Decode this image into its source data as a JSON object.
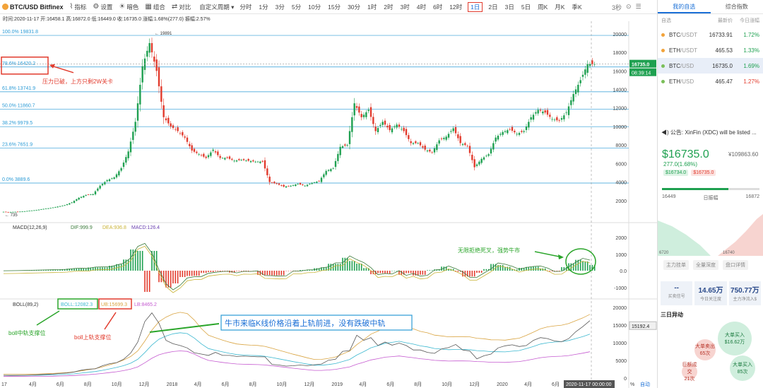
{
  "toolbar": {
    "pair": "BTC/USD Bitfinex",
    "tools": [
      {
        "icon": "indicator-icon",
        "glyph": "⌇",
        "label": "指标"
      },
      {
        "icon": "gear-icon",
        "glyph": "⚙",
        "label": "设置"
      },
      {
        "icon": "sun-icon",
        "glyph": "☀",
        "label": "暗色"
      },
      {
        "icon": "combo-icon",
        "glyph": "▦",
        "label": "组合"
      },
      {
        "icon": "compare-icon",
        "glyph": "⇄",
        "label": "对比"
      }
    ],
    "custom": "自定义周期 ▾",
    "periods": [
      "分时",
      "1分",
      "3分",
      "5分",
      "10分",
      "15分",
      "30分",
      "1时",
      "2时",
      "3时",
      "4时",
      "6时",
      "12时",
      "1日",
      "2日",
      "3日",
      "5日",
      "周K",
      "月K",
      "季K"
    ],
    "selected_period": "1日",
    "right": [
      "3秒",
      "⊙",
      "☰"
    ]
  },
  "ohlc": "时间:2020-11-17  开:16458.1  高:16872.0  低:16449.0  收:16735.0  涨幅:1.68%(277.0)   振幅:2.57%",
  "main_chart": {
    "fib_levels": [
      {
        "label": "100.0% 19831.8",
        "value": 19831.8
      },
      {
        "label": "78.6% 16420.2",
        "value": 16420.2
      },
      {
        "label": "61.8% 13741.9",
        "value": 13741.9
      },
      {
        "label": "50.0% 11860.7",
        "value": 11860.7
      },
      {
        "label": "38.2% 9979.5",
        "value": 9979.5
      },
      {
        "label": "23.6% 7651.9",
        "value": 7651.9
      },
      {
        "label": "0.0% 3889.6",
        "value": 3889.6
      }
    ],
    "high_label": "19891",
    "low_label": "735",
    "yticks": [
      2000,
      4000,
      6000,
      8000,
      10000,
      12000,
      14000,
      16000,
      18000,
      20000
    ],
    "price_tag": "16735.0",
    "countdown": "08:39:14",
    "annotation": "压力已破，上方只剩2W关卡",
    "close_series": [
      800,
      760,
      790,
      820,
      900,
      980,
      1100,
      1200,
      1350,
      1500,
      1800,
      2300,
      2600,
      2700,
      3600,
      4200,
      4500,
      5500,
      7300,
      10500,
      16500,
      19000,
      16000,
      11000,
      10000,
      9500,
      8800,
      7400,
      7000,
      6600,
      7500,
      6600,
      6600,
      6300,
      6400,
      6300,
      6200,
      6200,
      4000,
      3800,
      3500,
      3600,
      3800,
      3600,
      3900,
      4100,
      5200,
      5500,
      7800,
      8000,
      12500,
      11000,
      11800,
      9500,
      10500,
      9600,
      10200,
      9500,
      8200,
      8200,
      7500,
      7200,
      8500,
      8900,
      9800,
      8200,
      7900,
      5600,
      6500,
      7000,
      8800,
      9400,
      9700,
      9200,
      9500,
      11000,
      11800,
      11500,
      10800,
      10600,
      11500,
      13500,
      15000,
      16735
    ]
  },
  "macd": {
    "label": "MACD(12,26,9)",
    "dif": "DIF:999.9",
    "dea": "DEA:936.8",
    "macd": "MACD:126.4",
    "yticks": [
      "2000",
      "1000",
      "0.0",
      "-1000"
    ],
    "annotation": "无限拒绝死叉，强势牛市"
  },
  "boll": {
    "label": "BOLL(89,2)",
    "boll": "BOLL:12082.3",
    "ub": "UB:15699.3",
    "lb": "LB:8465.2",
    "yticks": [
      "20000",
      "15000",
      "10000",
      "5000",
      "0"
    ],
    "price_tag": "15192.4",
    "annot_mid": "boll中轨支撑位",
    "annot_ub": "boll上轨支撑位",
    "annot_main": "牛市来临K线价格沿着上轨前进，没有跌破中轨"
  },
  "xaxis": [
    "17",
    "4月",
    "6月",
    "8月",
    "10月",
    "12月",
    "2018",
    "4月",
    "6月",
    "8月",
    "10月",
    "12月",
    "2019",
    "4月",
    "6月",
    "8月",
    "10月",
    "12月",
    "2020",
    "4月",
    "6月",
    "8月"
  ],
  "xaxis_cursor": "2020-11-17 00:00:00",
  "xaxis_right": [
    "%",
    "自动"
  ],
  "colors": {
    "up": "#1ea050",
    "down": "#e23b2d",
    "fib": "#2b9bd6",
    "annot": "#e23b2d",
    "boll_mid": "#3cb8d0",
    "boll_ub": "#d9a441",
    "boll_lb": "#c55ad0",
    "dif": "#3a7a3a",
    "dea": "#c9b336"
  },
  "sidebar": {
    "tabs": [
      "我的自选",
      "综合指数"
    ],
    "header": [
      "自选",
      "最新价",
      "今日涨幅"
    ],
    "items": [
      {
        "symbol": "BTC",
        "quote": "/USDT",
        "price": "16733.91",
        "change": "1.72%",
        "dot": "#f2a33a",
        "color": "#1ea050",
        "selected": false
      },
      {
        "symbol": "ETH",
        "quote": "/USDT",
        "price": "465.53",
        "change": "1.33%",
        "dot": "#f2a33a",
        "color": "#1ea050",
        "selected": false
      },
      {
        "symbol": "BTC",
        "quote": "/USD",
        "price": "16735.0",
        "change": "1.69%",
        "dot": "#7bbf5a",
        "color": "#1ea050",
        "selected": true
      },
      {
        "symbol": "ETH",
        "quote": "/USD",
        "price": "465.47",
        "change": "1.27%",
        "dot": "#7bbf5a",
        "color": "#e23b2d",
        "selected": false
      }
    ],
    "notice": "◀) 公告: XinFin (XDC) will be listed ...",
    "big_price": "$16735.0",
    "cny": "¥109863.60",
    "change": "277.0(1.68%)",
    "bid": "$16734.0",
    "ask": "$16735.0",
    "low": "16449",
    "high": "16872",
    "range_mid": "日振幅",
    "range_pos": 0.68,
    "depth_left": "6720",
    "depth_right": "16740",
    "buttons": [
      "主力挂单",
      "全量深度",
      "盘口详情"
    ],
    "stats": [
      {
        "v": "--",
        "l": "买卖信号"
      },
      {
        "v": "14.65万",
        "l": "今日关注度"
      },
      {
        "v": "750.77万",
        "l": "主力净流入$"
      }
    ],
    "section": "三日异动",
    "bubbles": [
      {
        "t": "大单买入",
        "v": "$16.62万"
      },
      {
        "t": "大单卖出",
        "v": "65次"
      },
      {
        "t": "大单买入",
        "v": "85次"
      },
      {
        "t": "巨额成交",
        "v": "21次"
      }
    ]
  }
}
